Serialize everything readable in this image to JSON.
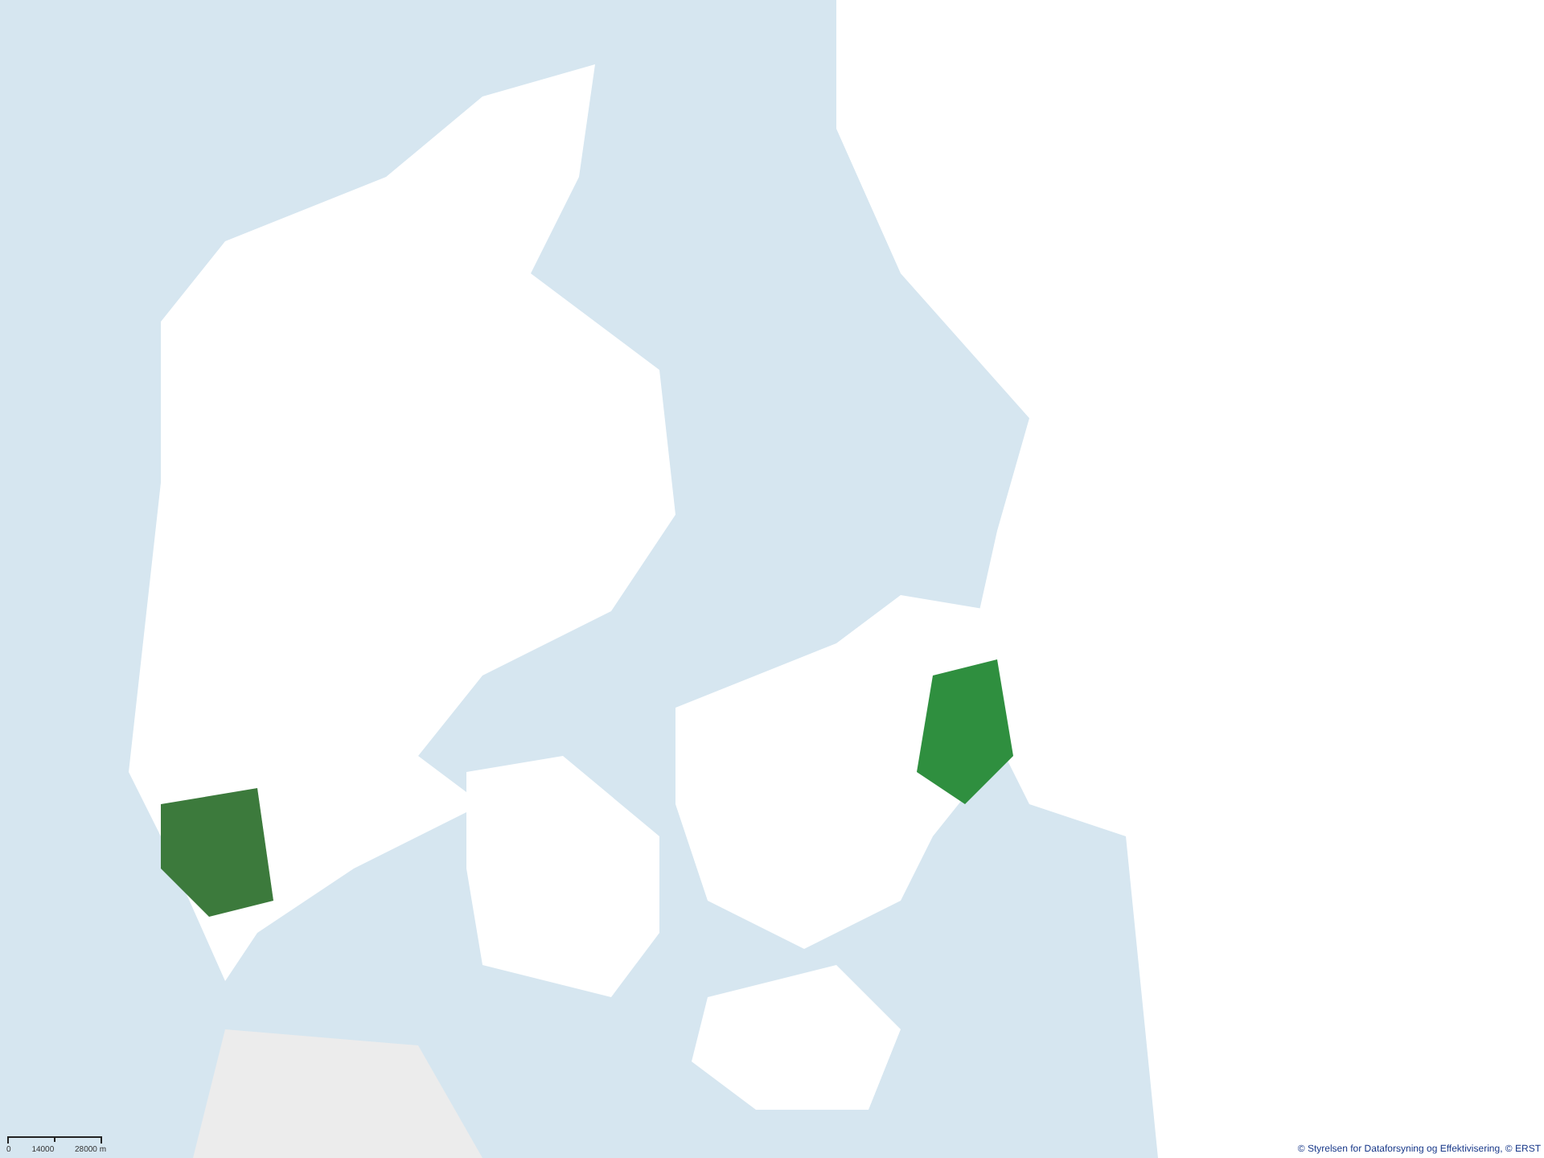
{
  "map": {
    "scale_bar": {
      "labels": [
        "0",
        "14000",
        "28000 m"
      ]
    },
    "attribution": "© Styrelsen for Dataforsyning og Effektivisering, © ERST"
  }
}
